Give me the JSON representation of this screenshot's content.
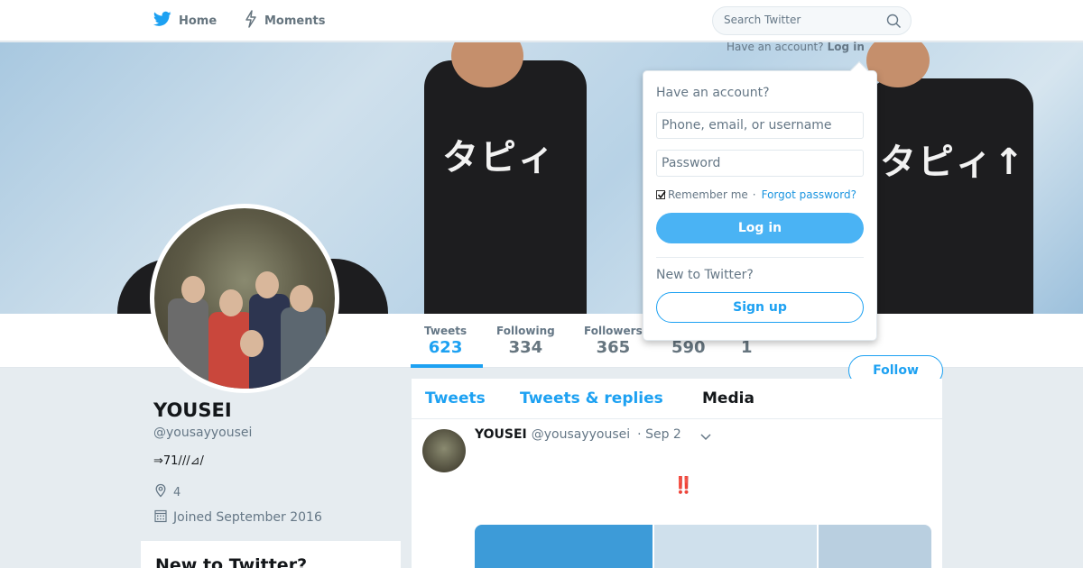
{
  "nav": {
    "home_label": "Home",
    "moments_label": "Moments",
    "search_placeholder": "Search Twitter"
  },
  "login_prompt": {
    "text": "Have an account?",
    "link": "Log in"
  },
  "login_dropdown": {
    "title": "Have an account?",
    "username_placeholder": "Phone, email, or username",
    "password_placeholder": "Password",
    "remember_label": "Remember me",
    "separator": "·",
    "forgot_link": "Forgot password?",
    "login_button": "Log in",
    "new_label": "New to Twitter?",
    "signup_button": "Sign up"
  },
  "banner": {
    "shirt_text": "タピィ",
    "shirt_text_2": "タピィ↑"
  },
  "stats": [
    {
      "label": "Tweets",
      "value": "623"
    },
    {
      "label": "Following",
      "value": "334"
    },
    {
      "label": "Followers",
      "value": "365"
    },
    {
      "label": "",
      "value": "590"
    },
    {
      "label": "",
      "value": "1"
    }
  ],
  "follow_button": "Follow",
  "profile": {
    "name": "YOUSEI",
    "handle": "@yousayyousei",
    "bio": "⇒71///⊿/",
    "location": "4",
    "joined": "Joined September 2016"
  },
  "side_card": {
    "title": "New to Twitter?"
  },
  "timeline": {
    "tabs": [
      "Tweets",
      "Tweets & replies",
      "Media"
    ],
    "tweet": {
      "name": "YOUSEI",
      "handle": "@yousayyousei",
      "date": "· Sep 2",
      "text": "‼️"
    }
  },
  "colors": {
    "brand": "#1da1f2",
    "background": "#e6ecf0"
  }
}
